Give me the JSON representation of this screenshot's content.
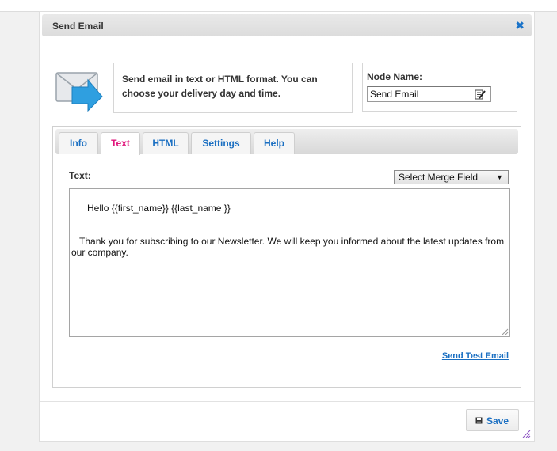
{
  "dialog": {
    "title": "Send Email",
    "close_icon": "close-icon",
    "description": "Send email in text or HTML format. You can choose your delivery day and time."
  },
  "node": {
    "label": "Node Name:",
    "value": "Send Email",
    "edit_icon": "edit-icon"
  },
  "tabs": [
    {
      "label": "Info",
      "active": false
    },
    {
      "label": "Text",
      "active": true
    },
    {
      "label": "HTML",
      "active": false
    },
    {
      "label": "Settings",
      "active": false
    },
    {
      "label": "Help",
      "active": false
    }
  ],
  "text_tab": {
    "label": "Text:",
    "merge_field": "Select Merge Field",
    "body": "Hello {{first_name}} {{last_name }}\n\n\n   Thank you for subscribing to our Newsletter. We will keep you informed about the latest updates from our company.",
    "send_test": "Send Test Email"
  },
  "footer": {
    "save_label": "Save",
    "save_icon": "save-icon"
  },
  "colors": {
    "link": "#1a6fc2",
    "active_tab": "#e0157b",
    "icon_blue": "#2f9fe0"
  }
}
